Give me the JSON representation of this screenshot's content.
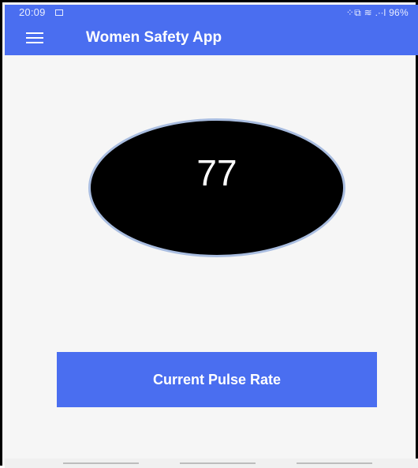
{
  "status_bar": {
    "time": "20:09",
    "right_text": "⁘⧉ ≋ .∙∙l 96%"
  },
  "app_bar": {
    "title": "Women Safety App",
    "menu_icon": "hamburger-menu-icon"
  },
  "pulse": {
    "value": "77"
  },
  "button": {
    "label": "Current Pulse Rate"
  },
  "colors": {
    "primary": "#4a6ef0",
    "circle": "#000000",
    "circle_border": "#a9bde0",
    "background": "#f6f6f6"
  }
}
